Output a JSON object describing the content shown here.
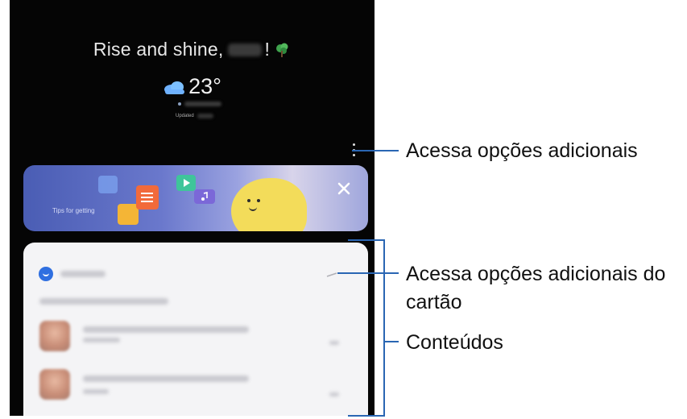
{
  "screen": {
    "greeting": "Rise and shine,",
    "greeting_suffix": "!",
    "weather": {
      "temperature": "23°",
      "updated_label": "Updated"
    },
    "banner": {
      "text": "Tips for getting"
    },
    "card": {}
  },
  "callouts": {
    "more_options": "Acessa opções adicionais",
    "card_options_line1": "Acessa opções adicionais do",
    "card_options_line2": "cartão",
    "contents": "Conteúdos"
  },
  "colors": {
    "phone_bg": "#050505",
    "callout_line": "#2a66b3",
    "banner_gradient_start": "#4a5db4",
    "card_bg": "#f4f4f6",
    "moon": "#f3dc5a"
  },
  "icons": [
    "cloud-icon",
    "tree-icon",
    "more-vertical-icon",
    "close-icon",
    "app-icon",
    "more-horizontal-icon",
    "play-icon",
    "music-note-icon"
  ]
}
